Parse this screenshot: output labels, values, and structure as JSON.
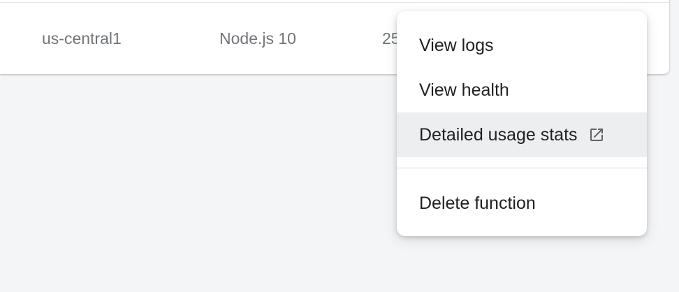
{
  "table": {
    "row": {
      "region": "us-central1",
      "runtime": "Node.js 10",
      "memory_truncated": "25"
    }
  },
  "menu": {
    "items": [
      {
        "label": "View logs"
      },
      {
        "label": "View health"
      },
      {
        "label": "Detailed usage stats",
        "icon": "open-in-new-icon",
        "hovered": true
      },
      {
        "label": "Delete function"
      }
    ]
  },
  "colors": {
    "background": "#f4f5f7",
    "card": "#ffffff",
    "hover": "#eceeef",
    "text_primary": "#202124",
    "text_secondary": "#717478"
  }
}
